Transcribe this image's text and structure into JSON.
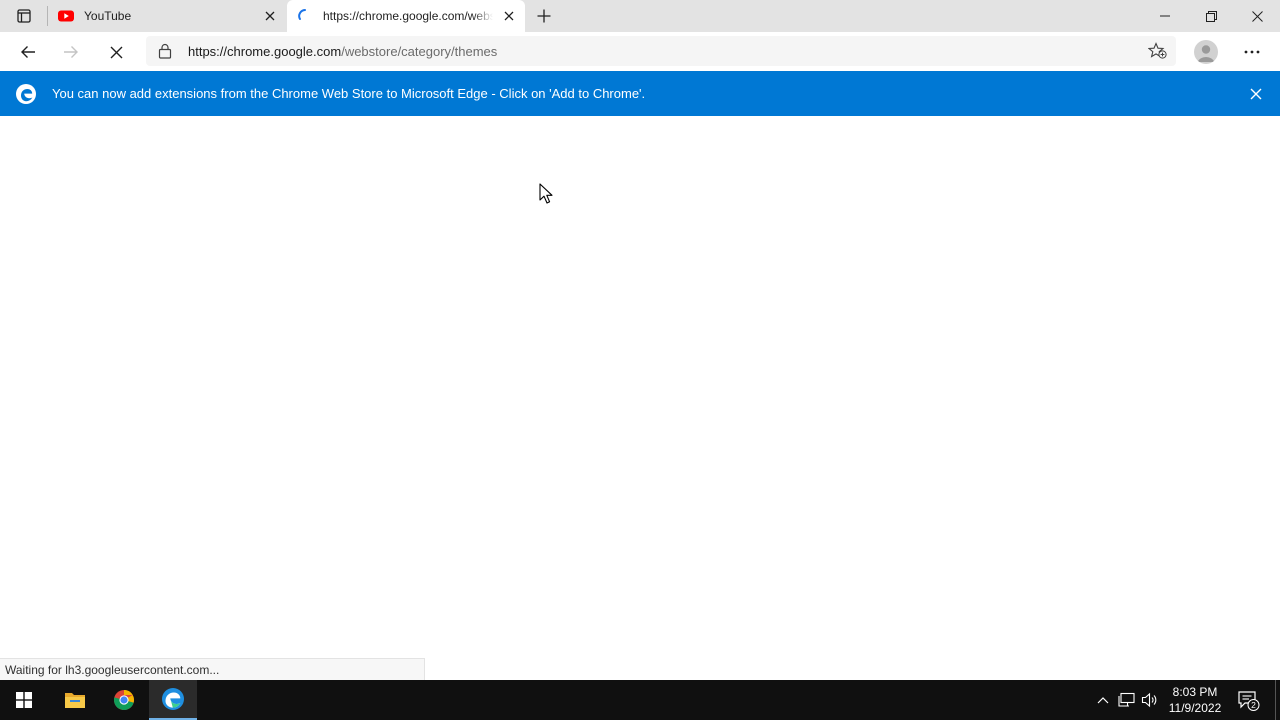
{
  "tabs": [
    {
      "title": "YouTube",
      "favicon": "youtube-icon",
      "active": false
    },
    {
      "title": "https://chrome.google.com/webstore/category/themes",
      "favicon": "loading-icon",
      "active": true
    }
  ],
  "toolbar": {
    "url_host": "https://chrome.google.com",
    "url_path": "/webstore/category/themes"
  },
  "infobar": {
    "message": "You can now add extensions from the Chrome Web Store to Microsoft Edge - Click on 'Add to Chrome'."
  },
  "status": {
    "text": "Waiting for lh3.googleusercontent.com..."
  },
  "taskbar": {
    "time": "8:03 PM",
    "date": "11/9/2022",
    "notification_count": "2"
  },
  "colors": {
    "accent": "#0078d4",
    "youtube": "#ff0000"
  }
}
